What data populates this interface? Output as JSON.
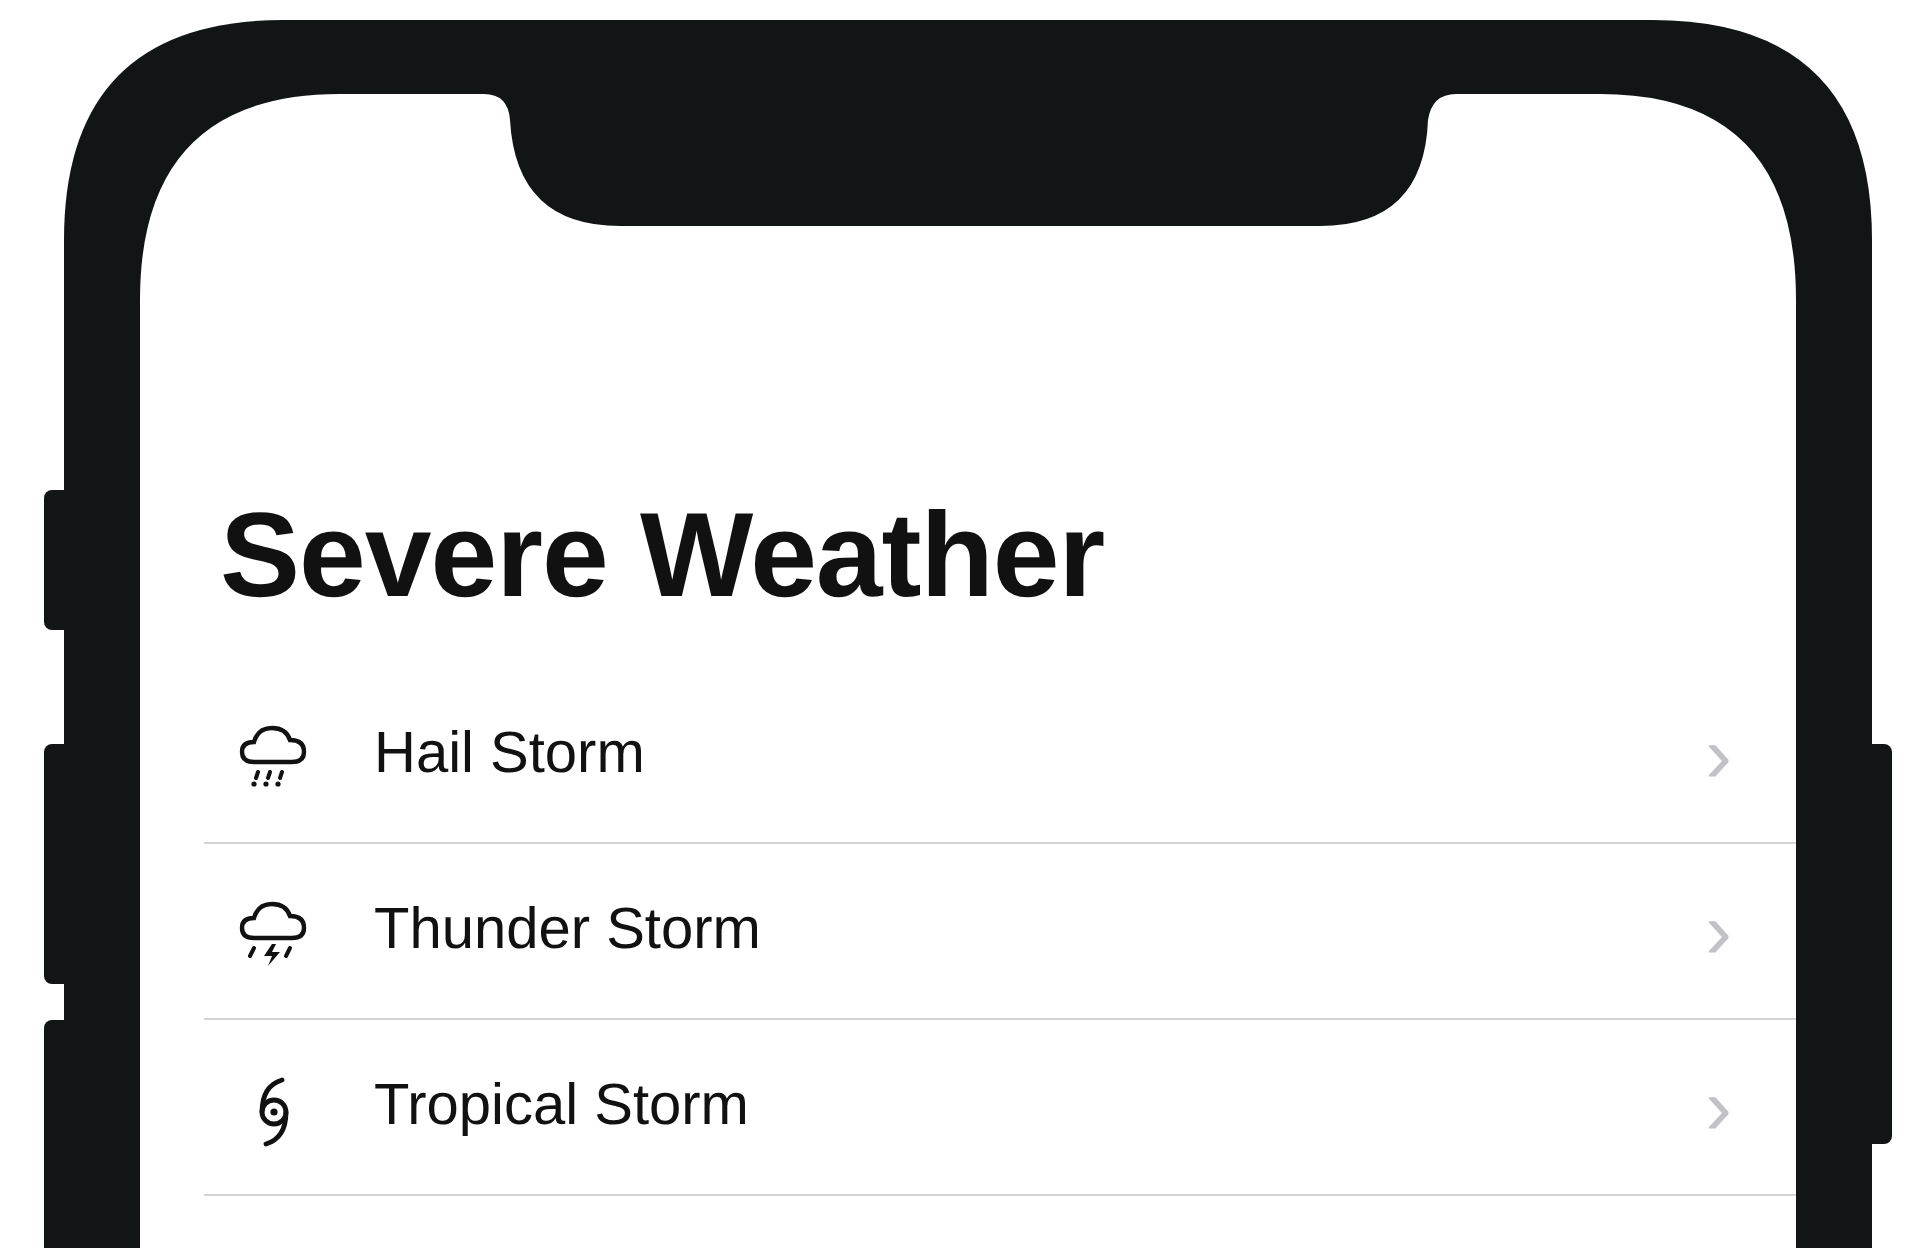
{
  "title": "Severe Weather",
  "items": [
    {
      "label": "Hail Storm",
      "kind": "hail"
    },
    {
      "label": "Thunder Storm",
      "kind": "thunder"
    },
    {
      "label": "Tropical Storm",
      "kind": "tropical"
    }
  ],
  "chevron": "›"
}
